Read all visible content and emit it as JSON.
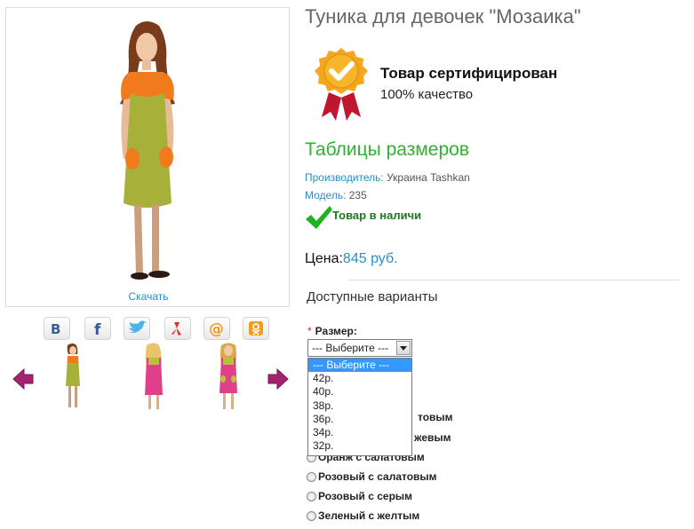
{
  "product": {
    "title": "Туника для девочек \"Мозаика\"",
    "download_label": "Скачать"
  },
  "share_icons": [
    "vk-icon",
    "facebook-icon",
    "twitter-icon",
    "odnoklassniki-icon",
    "mailru-icon",
    "ok-icon"
  ],
  "certificate": {
    "title": "Товар сертифицирован",
    "subtitle": "100% качество"
  },
  "size_tables_link": "Таблицы размеров",
  "meta": {
    "manufacturer_key": "Производитель:",
    "manufacturer_value": " Украина Tashkan",
    "model_key": "Модель:",
    "model_value": " 235"
  },
  "stock": "Товар в наличи",
  "price": {
    "label": "Цена:",
    "value": "845 руб."
  },
  "variants": {
    "title": "Доступные варианты",
    "size_label": "Размер:",
    "required_mark": "*",
    "selected": "--- Выберите ---",
    "options": [
      "--- Выберите ---",
      "42р.",
      "40р.",
      "38р.",
      "36р.",
      "34р.",
      "32р."
    ],
    "colors_visible": [
      "товым",
      "жевым",
      "Оранж с салатовым",
      "Розовый с салатовым",
      "Розовый с серым",
      "Зеленый с желтым"
    ]
  },
  "colors": {
    "accent_blue": "#2a8fc7",
    "accent_green": "#2fb22f",
    "stock_green": "#1f7a1f",
    "selection_blue": "#3399ff"
  }
}
